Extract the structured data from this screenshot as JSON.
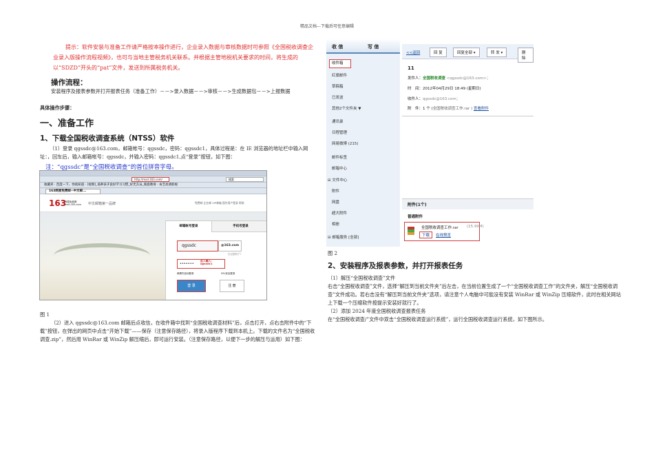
{
  "header": "精品文档---下载后可任意编辑",
  "tip": "提示：软件安装与准备工作请严格按本操作进行，企业录入数据与审核数据时可参照《全国税收调查企业录入版操作流程视频》，也可与当地主管税务机关联系。并根据主管地税机关要求的时间，将生成的以“SDZD”开头的“pat”文件，发送到所属税务机关。",
  "flow_title": "操作流程：",
  "flow_text": "安装程序及报表参数并打开报表任务（准备工作）－－>录入数据－－>审核－－>生成数据包－－>上报数据",
  "steps_title": "具体操作步骤：",
  "section1": "一、准备工作",
  "s1_title": "1、下载全国税收调查系统（NTSS）软件",
  "s1_p1": "（1）登录 qgssdc@163.com，邮箱帐号：qgssdc，密码：qgssdc1，具体过程是：在 IE 浏览器的地址栏中输入网址：，回车后，输入邮箱帐号：qgssdc，并输入密码：qgssdc1,点“登录”按钮，如下图：",
  "s1_note": "注：“qgssdc”是“全国税收调查”的首位拼音字母。",
  "fig1": {
    "address": "http://mail.163.com/",
    "search": "搜索",
    "favorites": "收藏夹 · 百度一下，你就知道 · [视频]_培养孩子良好学习习惯_好无方法_家庭教育 · 肯艺高清影视",
    "tab": "163网易免费邮--中文邮...",
    "logo": "163",
    "logo_sub": "网易免费邮 mail.163.com",
    "slogan": "中文邮箱第一品牌",
    "links": "免费邮  企业邮  VIP邮箱  国外用户登录  帮助",
    "tab_account": "邮箱帐号登录",
    "tab_mobile": "手机号登录",
    "username": "qgssdc",
    "domain": "@163.com",
    "forgot": "忘记密码了?",
    "password": "•••••••",
    "pwd_hint": "此入输入: qgssdc1",
    "auto_login": "两周内自动登录",
    "ssl": "SSL安全登录",
    "login": "登 录",
    "register": "注 册"
  },
  "fig1_caption": "图 1",
  "s1_p2": "（2）进入 qgssdc@163.com 邮箱后点收信，在收件箱中找到“全国税收调查材料”后，点击打开，点右击附件中的“下载”按钮，在弹出的网页中点击“开始下载”——保存（注意保存路径），将录入版程序下载到本机上。下载的文件名为“全国税收调查.zip”，然后用 WinRar 或 WinZip 解压缩后，即可运行安装。（注意保存路径，以便下一步的解压与运用）如下图：",
  "fig2": {
    "receive": "收 信",
    "write": "写 信",
    "folders": [
      "收件箱",
      "红旗邮件",
      "草稿箱",
      "已发送",
      "其他2个文件夹 ▼"
    ],
    "tools": [
      "通讯录",
      "日程管理",
      "网易微博 (215)"
    ],
    "groups": [
      "邮件标签",
      "邮箱中心",
      "⊟ 文件中心",
      "附件",
      "网盘",
      "超大附件",
      "相册",
      "⊟ 邮箱服务 [全部]"
    ],
    "toolbar": [
      "<<返回",
      "回 复",
      "回复全部 ▾",
      "转 发 ▾",
      "删 除"
    ],
    "count": "11",
    "from_label": "发件人：",
    "from_name": "全国税收调查",
    "from_addr": "<qgssdc@163.com>；",
    "time_label": "时　间：",
    "time": "2012年04月29日 18:49 (星期日)",
    "to_label": "收件人：",
    "to": "qgssdc@163.com；",
    "att_label": "附　件：",
    "att_count": "1 个 (",
    "att_file": "全国税收调查工作.rar )",
    "view_att": "查看附件",
    "att_header": "附件(1个)",
    "att_normal": "普通附件",
    "file": "全国税收调查工作.rar",
    "size": "(15.99M)",
    "download": "下载",
    "preview": "在线预览"
  },
  "fig2_caption": "图 2",
  "s2_title": "2、安装程序及报表参数，并打开报表任务",
  "s2_p1": "（1）解压“全国税收调查”文件",
  "s2_p2": "右击“全国税收调查”文件，选择“解压到当前文件夹”后左击，在当前位置生成了一个“全国税收调查工作”的文件夹，解压“全国税收调查”文件成功。若右击没有“解压到当前文件夹”选项，请注意个人电脑中可能没有安装 WinRar 或 WinZip 压缩软件，此时在相关网站上下载一个压缩软件按提示安装好就行了。",
  "s2_p3": "（2）添加 2024 年度全国税收调查报表任务",
  "s2_p4": "在“全国税收调查/”文件中双击“全国税收调查运行系统”，运行全国税收调查运行系统，如下图所示。"
}
